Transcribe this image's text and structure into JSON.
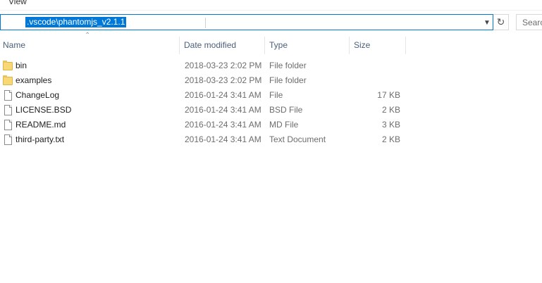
{
  "menubar": {
    "view_label": "View"
  },
  "address": {
    "path": ".vscode\\phantomjs_v2.1.1"
  },
  "search": {
    "placeholder": "Searc"
  },
  "columns": {
    "name": "Name",
    "date": "Date modified",
    "type": "Type",
    "size": "Size"
  },
  "icons": {
    "refresh": "refresh-icon",
    "dropdown": "chevron-down-icon",
    "sort": "sort-up-icon",
    "folder": "folder-icon",
    "file": "file-icon"
  },
  "colors": {
    "accent": "#0078d7",
    "header_text": "#4c607a",
    "folder": "#f8d775"
  },
  "files": [
    {
      "name": "bin",
      "date": "2018-03-23 2:02 PM",
      "type": "File folder",
      "size": ""
    },
    {
      "name": "examples",
      "date": "2018-03-23 2:02 PM",
      "type": "File folder",
      "size": ""
    },
    {
      "name": "ChangeLog",
      "date": "2016-01-24 3:41 AM",
      "type": "File",
      "size": "17 KB"
    },
    {
      "name": "LICENSE.BSD",
      "date": "2016-01-24 3:41 AM",
      "type": "BSD File",
      "size": "2 KB"
    },
    {
      "name": "README.md",
      "date": "2016-01-24 3:41 AM",
      "type": "MD File",
      "size": "3 KB"
    },
    {
      "name": "third-party.txt",
      "date": "2016-01-24 3:41 AM",
      "type": "Text Document",
      "size": "2 KB"
    }
  ]
}
